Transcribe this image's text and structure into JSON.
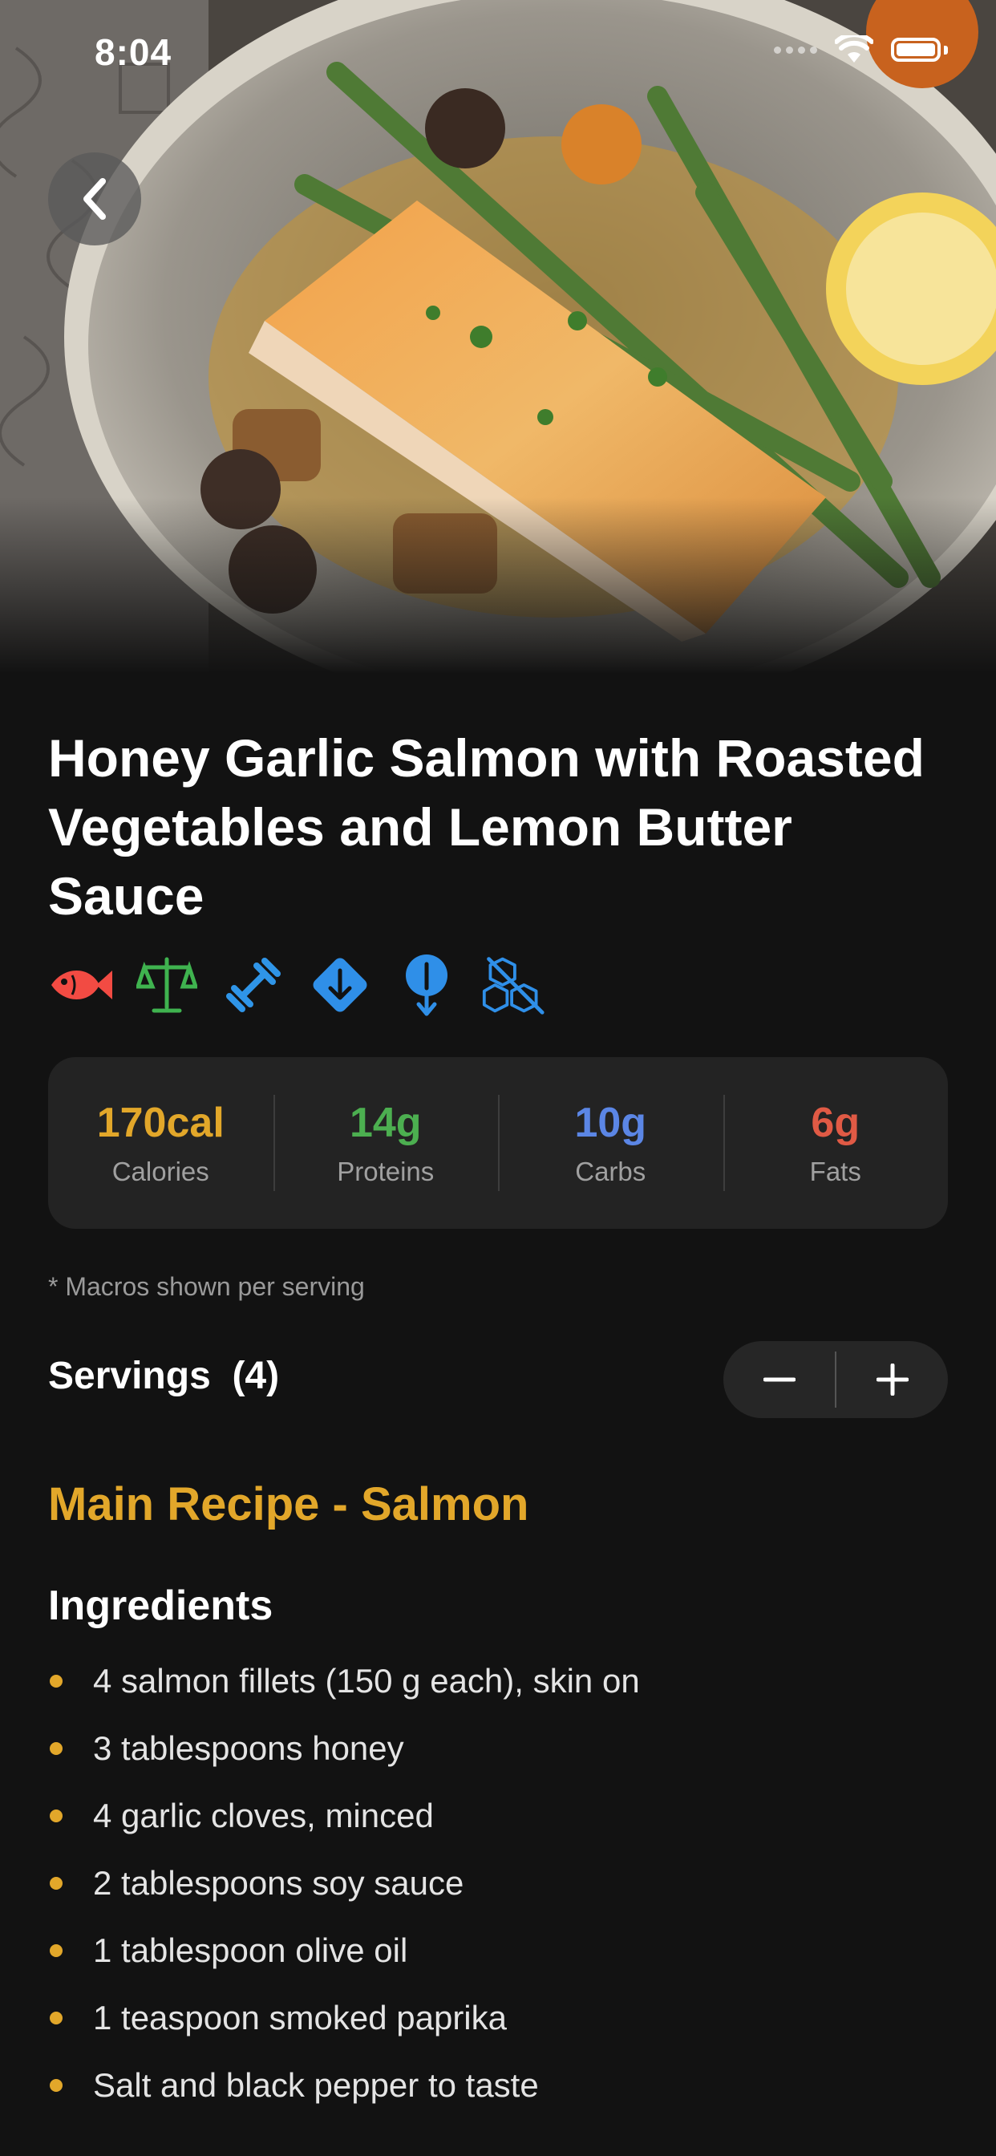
{
  "status_bar": {
    "time": "8:04"
  },
  "recipe": {
    "title": "Honey Garlic Salmon with Roasted Vegetables and Lemon Butter Sauce",
    "tag_icons": [
      "fish-icon",
      "balance-scale-icon",
      "dumbbell-icon",
      "arrow-down-diamond-icon",
      "arrow-down-pin-icon",
      "cubes-slash-icon"
    ],
    "macros": [
      {
        "value": "170cal",
        "label": "Calories",
        "color": "#e2a72a"
      },
      {
        "value": "14g",
        "label": "Proteins",
        "color": "#4caf50"
      },
      {
        "value": "10g",
        "label": "Carbs",
        "color": "#5b86e5"
      },
      {
        "value": "6g",
        "label": "Fats",
        "color": "#e05a45"
      }
    ],
    "macro_note": "* Macros shown per serving",
    "servings_label": "Servings",
    "servings_count": "(4)",
    "section_title": "Main Recipe - Salmon",
    "ingredients_title": "Ingredients",
    "ingredients": [
      "4 salmon fillets (150 g each), skin on",
      "3 tablespoons honey",
      "4 garlic cloves, minced",
      "2 tablespoons soy sauce",
      "1 tablespoon olive oil",
      "1 teaspoon smoked paprika",
      "Salt and black pepper to taste"
    ]
  }
}
